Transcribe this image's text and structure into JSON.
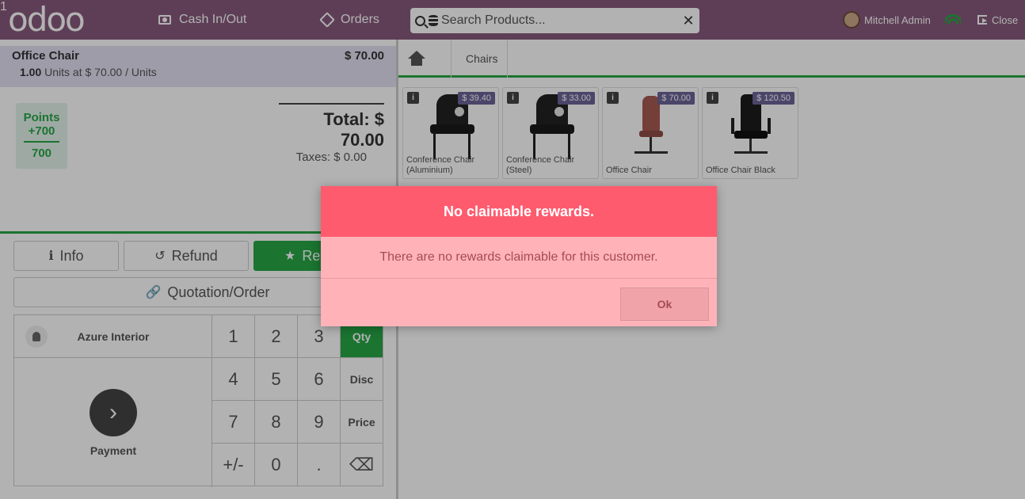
{
  "header": {
    "logo": "odoo",
    "cash_label": "Cash In/Out",
    "orders_label": "Orders",
    "orders_badge": "1",
    "search_placeholder": "Search Products...",
    "user_name": "Mitchell Admin",
    "close_label": "Close"
  },
  "order": {
    "line_name": "Office Chair",
    "line_price": "$ 70.00",
    "line_qty": "1.00",
    "line_detail": "Units at $ 70.00 / Units",
    "points_label": "Points",
    "points_added": "+700",
    "points_total": "700",
    "total_label": "Total: $ 70.00",
    "taxes_label": "Taxes: $ 0.00"
  },
  "controls": {
    "info_label": "Info",
    "refund_label": "Refund",
    "reward_label": "Re",
    "quotation_label": "Quotation/Order"
  },
  "numpad": {
    "customer_name": "Azure Interior",
    "payment_label": "Payment",
    "keys": [
      "1",
      "2",
      "3",
      "Qty",
      "4",
      "5",
      "6",
      "Disc",
      "7",
      "8",
      "9",
      "Price",
      "+/-",
      "0",
      ".",
      "⌫"
    ]
  },
  "breadcrumb": {
    "category": "Chairs"
  },
  "products": [
    {
      "name": "Conference Chair (Aluminium)",
      "price": "$ 39.40"
    },
    {
      "name": "Conference Chair (Steel)",
      "price": "$ 33.00"
    },
    {
      "name": "Office Chair",
      "price": "$ 70.00"
    },
    {
      "name": "Office Chair Black",
      "price": "$ 120.50"
    }
  ],
  "dialog": {
    "title": "No claimable rewards.",
    "body": "There are no rewards claimable for this customer.",
    "ok_label": "Ok"
  },
  "colors": {
    "brand": "#875a7b",
    "accent": "#28a745",
    "danger": "#ff5b6e"
  }
}
